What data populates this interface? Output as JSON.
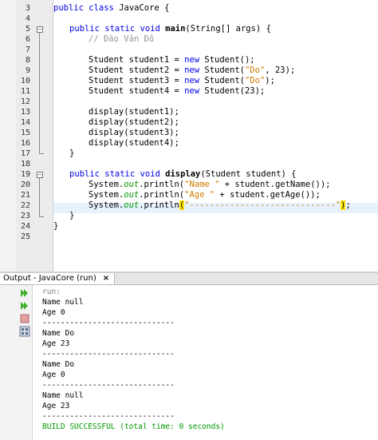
{
  "editor": {
    "line_numbers": [
      "3",
      "4",
      "5",
      "6",
      "7",
      "8",
      "9",
      "10",
      "11",
      "12",
      "13",
      "14",
      "15",
      "16",
      "17",
      "18",
      "19",
      "20",
      "21",
      "22",
      "23",
      "24",
      "25"
    ],
    "line3": {
      "kw": "public class",
      "name": "JavaCore",
      "rest": " {"
    },
    "line5": {
      "kw": "public static void",
      "name": "main",
      "rest": "(String[] args) {"
    },
    "line6": {
      "comment": "// Đào Văn Đô"
    },
    "line8": {
      "a": "Student student1 = ",
      "kw": "new",
      "b": " Student();"
    },
    "line9": {
      "a": "Student student2 = ",
      "kw": "new",
      "b": " Student(",
      "s": "\"Do\"",
      "c": ", 23);"
    },
    "line10": {
      "a": "Student student3 = ",
      "kw": "new",
      "b": " Student(",
      "s": "\"Do\"",
      "c": ");"
    },
    "line11": {
      "a": "Student student4 = ",
      "kw": "new",
      "b": " Student(23);"
    },
    "line13": "display(student1);",
    "line14": "display(student2);",
    "line15": "display(student3);",
    "line16": "display(student4);",
    "line17": "}",
    "line19": {
      "kw": "public static void",
      "name": "display",
      "rest": "(Student student) {"
    },
    "line20": {
      "a": "System.",
      "f": "out",
      "b": ".println(",
      "s": "\"Name \"",
      "c": " + student.getName());"
    },
    "line21": {
      "a": "System.",
      "f": "out",
      "b": ".println(",
      "s": "\"Age \"",
      "c": " + student.getAge());"
    },
    "line22": {
      "a": "System.",
      "f": "out",
      "b": ".println",
      "p1": "(",
      "s": "\"-----------------------------\"",
      "p2": ")",
      "c": ";"
    },
    "line23": "}",
    "line24": "}"
  },
  "output": {
    "tab_label": "Output - JavaCore (run)",
    "tab_close": "×",
    "lines": [
      "run:",
      "Name null",
      "Age 0",
      "-----------------------------",
      "Name Do",
      "Age 23",
      "-----------------------------",
      "Name Do",
      "Age 0",
      "-----------------------------",
      "Name null",
      "Age 23",
      "-----------------------------",
      "BUILD SUCCESSFUL (total time: 0 seconds)"
    ]
  },
  "colors": {
    "keyword": "#0000e6",
    "string": "#ce7b00",
    "field": "#009900",
    "comment": "#969696",
    "current_line": "#e8f2fe",
    "bracket_match": "#ffe400"
  },
  "icons": [
    "run-icon",
    "rerun-icon",
    "stop-icon",
    "settings-icon"
  ]
}
